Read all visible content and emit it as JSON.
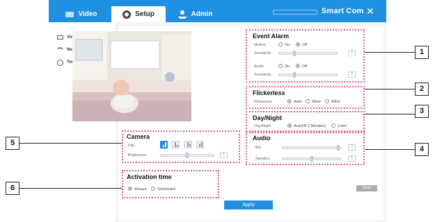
{
  "topbar": {
    "tabs": [
      {
        "label": "Video",
        "icon": "video-icon",
        "active": false
      },
      {
        "label": "Setup",
        "icon": "gear-icon",
        "active": true
      },
      {
        "label": "Admin",
        "icon": "admin-icon",
        "active": false
      }
    ],
    "brand": "Smart Com",
    "close_icon": "close-icon"
  },
  "sidebar": {
    "items": [
      {
        "label": "Video Setting",
        "icon": "monitor-icon"
      },
      {
        "label": "Network Setting",
        "icon": "wifi-icon"
      },
      {
        "label": "Time Setting",
        "icon": "clock-icon"
      }
    ]
  },
  "event_alarm": {
    "title": "Event Alarm",
    "motion_label": "Motion",
    "on_label": "On",
    "off_label": "Off",
    "motion_selected": "Off",
    "sensitivity_label": "Sensitivity",
    "motion_sensitivity_value": "2",
    "audio_label": "Audio",
    "audio_selected": "Off",
    "audio_sensitivity_value": "2"
  },
  "flickerless": {
    "title": "Flickerless",
    "label": "Flickerless",
    "options": [
      "Auto",
      "50Hz",
      "60Hz"
    ],
    "selected": "Auto"
  },
  "day_night": {
    "title": "Day/Night",
    "label": "Day/Night",
    "options": [
      "Auto(IR 2 Minutes)",
      "Color"
    ],
    "selected": "Auto(IR 2 Minutes)"
  },
  "audio": {
    "title": "Audio",
    "mic_label": "Mic",
    "mic_value": "3",
    "speaker_label": "Speaker",
    "speaker_value": "5"
  },
  "camera": {
    "title": "Camera",
    "flip_label": "Flip",
    "brightness_label": "Brightness",
    "brightness_value": "5"
  },
  "activation": {
    "title": "Activation time",
    "options": [
      "Always",
      "Scheduled"
    ],
    "selected": "Always"
  },
  "buttons": {
    "clear": "Clear",
    "apply": "Apply"
  },
  "callouts": [
    "1",
    "2",
    "3",
    "4",
    "5",
    "6"
  ],
  "colors": {
    "accent": "#1f8fe0",
    "dotted_border": "#e35a8a"
  }
}
